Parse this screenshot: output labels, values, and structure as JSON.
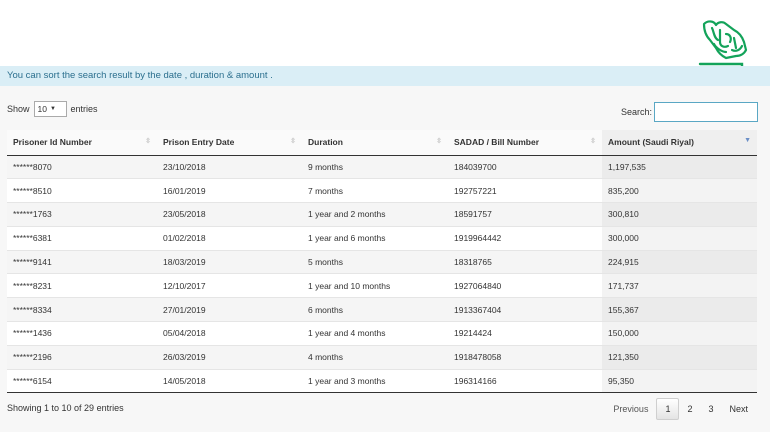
{
  "info_message": "You can sort the search result by the date , duration & amount .",
  "length": {
    "show_label": "Show",
    "value": "10",
    "entries_label": "entries"
  },
  "search": {
    "label": "Search:"
  },
  "table": {
    "columns": [
      "Prisoner Id Number",
      "Prison Entry Date",
      "Duration",
      "SADAD / Bill Number",
      "Amount (Saudi Riyal)"
    ],
    "sorted_column": "Amount (Saudi Riyal)",
    "sort_direction": "descending",
    "rows": [
      [
        "******8070",
        "23/10/2018",
        "9 months",
        "184039700",
        "1,197,535"
      ],
      [
        "******8510",
        "16/01/2019",
        "7 months",
        "192757221",
        "835,200"
      ],
      [
        "******1763",
        "23/05/2018",
        "1 year and 2 months",
        "18591757",
        "300,810"
      ],
      [
        "******6381",
        "01/02/2018",
        "1 year and 6 months",
        "1919964442",
        "300,000"
      ],
      [
        "******9141",
        "18/03/2019",
        "5 months",
        "18318765",
        "224,915"
      ],
      [
        "******8231",
        "12/10/2017",
        "1 year and 10 months",
        "1927064840",
        "171,737"
      ],
      [
        "******8334",
        "27/01/2019",
        "6 months",
        "1913367404",
        "155,367"
      ],
      [
        "******1436",
        "05/04/2018",
        "1 year and 4 months",
        "19214424",
        "150,000"
      ],
      [
        "******2196",
        "26/03/2019",
        "4 months",
        "1918478058",
        "121,350"
      ],
      [
        "******6154",
        "14/05/2018",
        "1 year and 3 months",
        "196314166",
        "95,350"
      ]
    ]
  },
  "summary": "Showing 1 to 10 of 29 entries",
  "pagination": {
    "previous": "Previous",
    "pages": [
      "1",
      "2",
      "3"
    ],
    "current": "1",
    "next": "Next"
  },
  "colors": {
    "brand_green": "#13a35a",
    "info_bg": "#daeef6",
    "info_text": "#2b6f8e",
    "search_border": "#5aa7c4"
  },
  "icons": {
    "logo": "saudi-map-calligraphy-logo",
    "sort": "sort-arrows-icon",
    "select_caret": "caret-down-icon"
  }
}
